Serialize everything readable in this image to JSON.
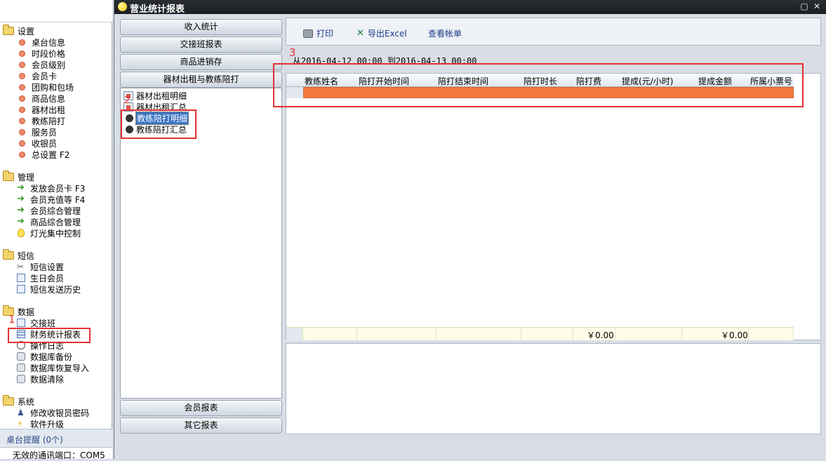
{
  "sidebar": {
    "groups": [
      {
        "label": "设置",
        "items": [
          "桌台信息",
          "时段价格",
          "会员级别",
          "会员卡",
          "团购和包场",
          "商品信息",
          "器材出租",
          "教练陪打",
          "服务员",
          "收银员",
          "总设置 F2"
        ]
      },
      {
        "label": "管理",
        "items": [
          "发放会员卡 F3",
          "会员充值等 F4",
          "会员综合管理",
          "商品综合管理",
          "灯光集中控制"
        ]
      },
      {
        "label": "短信",
        "items": [
          "短信设置",
          "生日会员",
          "短信发送历史"
        ]
      },
      {
        "label": "数据",
        "items": [
          "交接班",
          "财务统计报表",
          "操作日志",
          "数据库备份",
          "数据库恢复导入",
          "数据清除"
        ]
      },
      {
        "label": "系统",
        "items": [
          "修改收银员密码",
          "软件升级"
        ]
      }
    ],
    "table_reminder": "桌台提醒 (0个)",
    "status": "无效的通讯端口：COM5"
  },
  "annotations": {
    "one": "1",
    "two": "2",
    "three": "3"
  },
  "window": {
    "title": "营业统计报表",
    "nav": {
      "income": "收入统计",
      "shift": "交接班报表",
      "goods": "商品进销存",
      "equip_coach": "器材出租与教练陪打",
      "member": "会员报表",
      "other": "其它报表"
    },
    "subtree": [
      "器材出租明细",
      "器材出租汇总",
      "教练陪打明细",
      "教练陪打汇总"
    ],
    "toolbar": {
      "print": "打印",
      "export": "导出Excel",
      "view_bill": "查看帐单"
    },
    "date_range": "从2016-04-12 00:00  到2016-04-13 00:00",
    "grid": {
      "columns": [
        "教练姓名",
        "陪打开始时间",
        "陪打结束时间",
        "陪打时长",
        "陪打费",
        "提成(元/小时)",
        "提成金额",
        "所属小票号"
      ],
      "totals": {
        "fee": "￥0.00",
        "commission": "￥0.00"
      }
    }
  },
  "colors": {
    "selected_row": "#f2793d",
    "highlight": "#e53030"
  }
}
